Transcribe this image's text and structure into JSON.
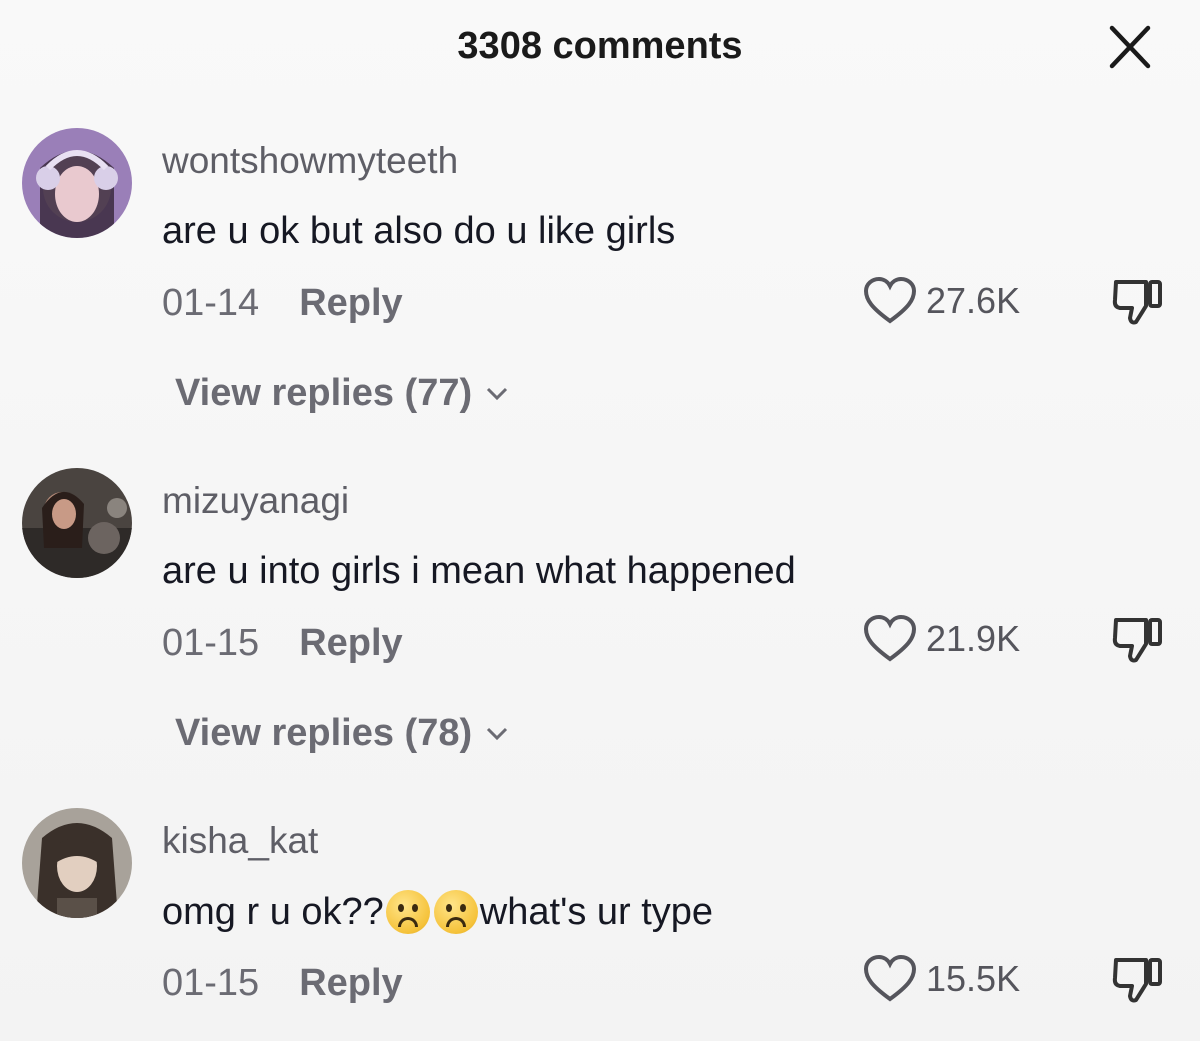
{
  "header": {
    "title": "3308 comments"
  },
  "comments": [
    {
      "username": "wontshowmyteeth",
      "text": "are u ok but also do u like girls",
      "date": "01-14",
      "reply_label": "Reply",
      "likes": "27.6K",
      "view_replies": "View replies (77)"
    },
    {
      "username": "mizuyanagi",
      "text": "are u into girls i mean what happened",
      "date": "01-15",
      "reply_label": "Reply",
      "likes": "21.9K",
      "view_replies": "View replies (78)"
    },
    {
      "username": "kisha_kat",
      "text_before_emoji": "omg r u ok??",
      "emoji": [
        "frowning-face",
        "frowning-face"
      ],
      "text_after_emoji": "what's ur type",
      "date": "01-15",
      "reply_label": "Reply",
      "likes": "15.5K"
    }
  ],
  "colors": {
    "background": "#f7f7f7",
    "primary_text": "#161823",
    "secondary_text": "#6b6b73",
    "username_text": "#5e5e66"
  }
}
